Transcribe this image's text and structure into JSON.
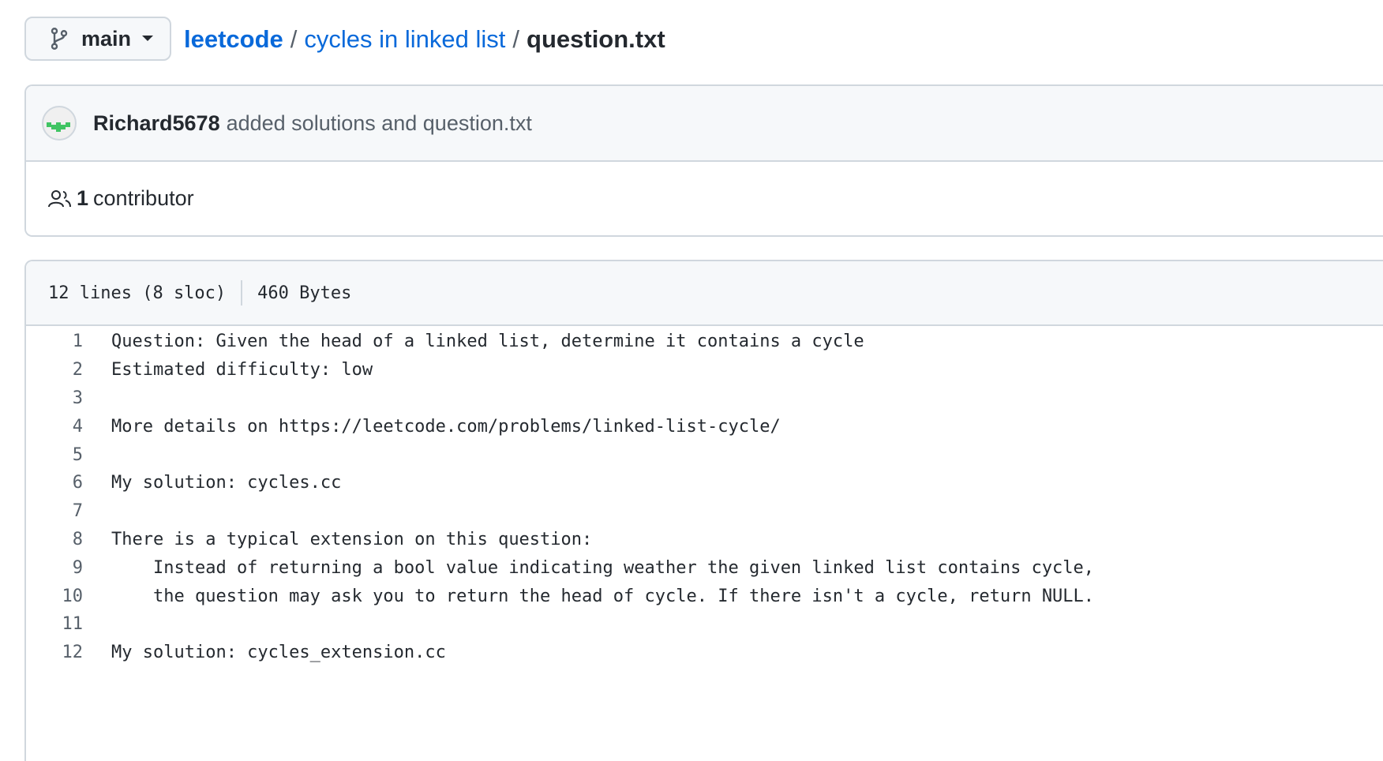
{
  "branch": {
    "name": "main"
  },
  "breadcrumb": {
    "repo": "leetcode",
    "folder": "cycles in linked list",
    "separator": "/",
    "file": "question.txt"
  },
  "commit": {
    "author": "Richard5678",
    "message": "added solutions and question.txt"
  },
  "contributors": {
    "count": "1",
    "label": "contributor"
  },
  "file_info": {
    "lines": "12 lines (8 sloc)",
    "size": "460 Bytes"
  },
  "code_lines": [
    {
      "num": "1",
      "text": "Question: Given the head of a linked list, determine it contains a cycle"
    },
    {
      "num": "2",
      "text": "Estimated difficulty: low"
    },
    {
      "num": "3",
      "text": ""
    },
    {
      "num": "4",
      "text": "More details on https://leetcode.com/problems/linked-list-cycle/"
    },
    {
      "num": "5",
      "text": ""
    },
    {
      "num": "6",
      "text": "My solution: cycles.cc"
    },
    {
      "num": "7",
      "text": ""
    },
    {
      "num": "8",
      "text": "There is a typical extension on this question:"
    },
    {
      "num": "9",
      "text": "    Instead of returning a bool value indicating weather the given linked list contains cycle,"
    },
    {
      "num": "10",
      "text": "    the question may ask you to return the head of cycle. If there isn't a cycle, return NULL."
    },
    {
      "num": "11",
      "text": ""
    },
    {
      "num": "12",
      "text": "My solution: cycles_extension.cc"
    }
  ],
  "colors": {
    "link": "#0969da",
    "border": "#d0d7de",
    "header_bg": "#f6f8fa",
    "avatar_green": "#40c463"
  },
  "icons": {
    "branch": "git-branch-icon",
    "caret": "triangle-down-icon",
    "people": "people-icon"
  }
}
